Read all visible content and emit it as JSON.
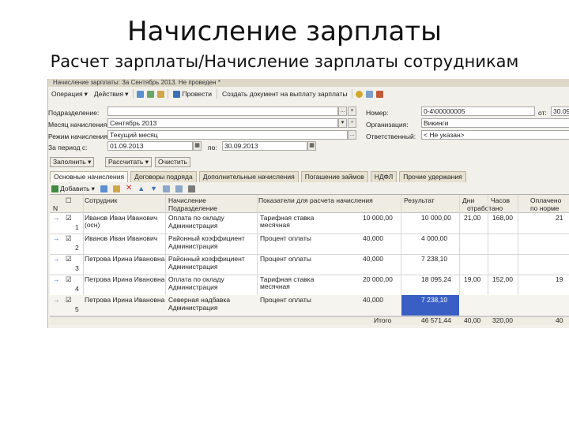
{
  "slide": {
    "title": "Начисление зарплаты",
    "subtitle": "Расчет зарплаты/Начисление зарплаты сотрудникам"
  },
  "window": {
    "title": "Начисление зарплаты: За Сентябрь 2013. Не проведен *"
  },
  "toolbar": {
    "operation": "Операция",
    "actions": "Действия",
    "post": "Провести",
    "create_doc": "Создать документ на выплату зарплаты"
  },
  "form": {
    "subdivision_label": "Подразделение:",
    "subdivision_value": "",
    "month_label": "Месяц начисления:",
    "month_value": "Сентябрь 2013",
    "mode_label": "Режим начисления:",
    "mode_value": "Текущий месяц",
    "period_label": "За период с:",
    "period_from": "01.09.2013",
    "period_to_label": "по:",
    "period_to": "30.09.2013",
    "number_label": "Номер:",
    "number_value": "0-4\\00000005",
    "date_label": "от:",
    "date_value": "30.09.",
    "org_label": "Организация:",
    "org_value": "Викинги",
    "responsible_label": "Ответственный:",
    "responsible_value": "< Не указан>"
  },
  "buttons": {
    "fill": "Заполнить",
    "calculate": "Рассчитать",
    "clear": "Очистить"
  },
  "tabs": [
    "Основные начисления",
    "Договоры подряда",
    "Дополнительные начисления",
    "Погашение займов",
    "НДФЛ",
    "Прочие удержания"
  ],
  "grid_toolbar": {
    "add": "Добавить"
  },
  "table": {
    "headers": {
      "n": "N",
      "employee": "Сотрудник",
      "accrual": "Начисление",
      "subdivision": "Подразделение",
      "indicators": "Показатели для расчета начисления",
      "result": "Результат",
      "days": "Дни",
      "hours": "Часов",
      "worked": "отработано",
      "payment": "Оплачено",
      "norm": "по норме"
    },
    "rows": [
      {
        "n": "1",
        "employee": "Иванов Иван Иванович",
        "employee2": "(осн)",
        "accrual": "Оплата по окладу",
        "subdivision": "Администрация",
        "indicator": "Тарифная ставка",
        "indicator2": "месячная",
        "indicator_value": "10 000,00",
        "result": "10 000,00",
        "days": "21,00",
        "hours": "168,00",
        "payment": "21"
      },
      {
        "n": "2",
        "employee": "Иванов Иван Иванович",
        "employee2": "",
        "accrual": "Районный коэффициент",
        "subdivision": "Администрация",
        "indicator": "Процент оплаты",
        "indicator2": "",
        "indicator_value": "40,000",
        "result": "4 000,00",
        "days": "",
        "hours": "",
        "payment": ""
      },
      {
        "n": "3",
        "employee": "Петрова Ирина Ивановна",
        "employee2": "",
        "accrual": "Районный коэффициент",
        "subdivision": "Администрация",
        "indicator": "Процент оплаты",
        "indicator2": "",
        "indicator_value": "40,000",
        "result": "7 238,10",
        "days": "",
        "hours": "",
        "payment": ""
      },
      {
        "n": "4",
        "employee": "Петрова Ирина Ивановна",
        "employee2": "",
        "accrual": "Оплата по окладу",
        "subdivision": "Администрация",
        "indicator": "Тарифная ставка",
        "indicator2": "месячная",
        "indicator_value": "20 000,00",
        "result": "18 095,24",
        "days": "19,00",
        "hours": "152,00",
        "payment": "19"
      },
      {
        "n": "5",
        "employee": "Петрова Ирина Ивановна",
        "employee2": "",
        "accrual": "Северная надбавка",
        "subdivision": "Администрация",
        "indicator": "Процент оплаты",
        "indicator2": "",
        "indicator_value": "40,000",
        "result": "7 238,10",
        "days": "",
        "hours": "",
        "payment": ""
      }
    ],
    "footer": {
      "label": "Итого",
      "result": "46 571,44",
      "days": "40,00",
      "hours": "320,00",
      "payment": "40"
    }
  },
  "colors": {
    "window_bg": "#f2f0ea",
    "selected_cell": "#3a5fc4",
    "toolbar_accent": "#3b6fb8"
  }
}
